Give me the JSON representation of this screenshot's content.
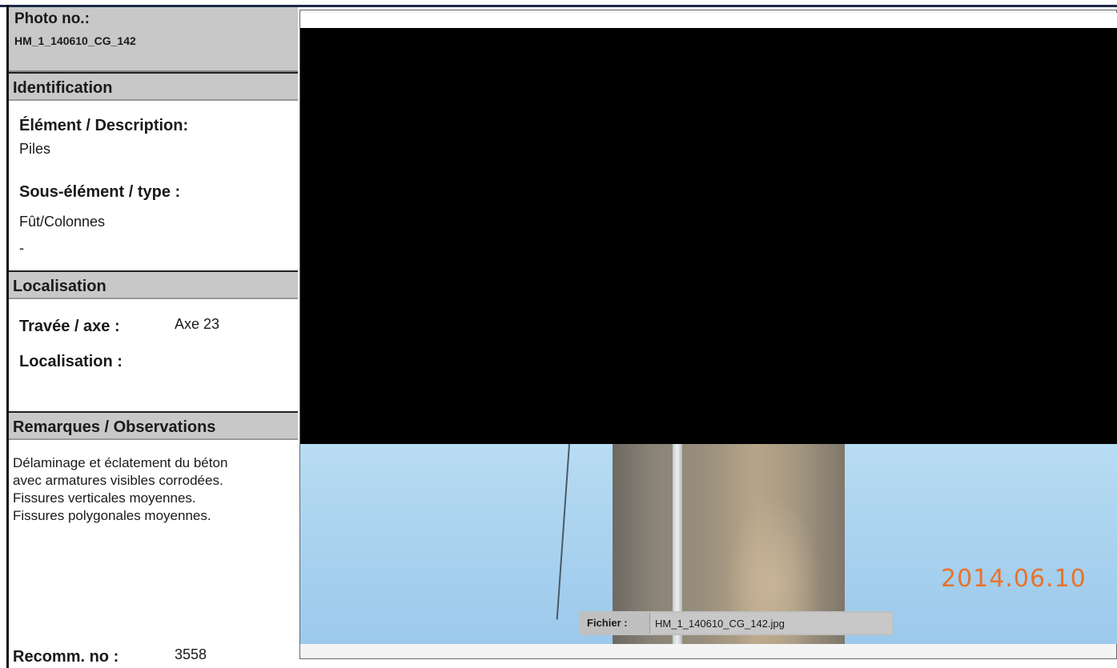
{
  "photo": {
    "label": "Photo no.:",
    "number": "HM_1_140610_CG_142"
  },
  "identification": {
    "header": "Identification",
    "element_label": "Élément / Description:",
    "element_value": "Piles",
    "subelement_label": "Sous-élément / type :",
    "subelement_value": "Fût/Colonnes",
    "extra": "-"
  },
  "localisation": {
    "header": "Localisation",
    "travee_label": "Travée / axe :",
    "travee_value": "Axe 23",
    "localisation_label": "Localisation :"
  },
  "remarks": {
    "header": "Remarques / Observations",
    "lines": [
      "Délaminage et éclatement du béton",
      "avec armatures visibles corrodées.",
      "Fissures verticales moyennes.",
      "Fissures polygonales moyennes."
    ]
  },
  "recommendation": {
    "label": "Recomm. no :",
    "value": "3558"
  },
  "image": {
    "date_stamp": "2014.06.10",
    "file_label": "Fichier :",
    "file_name": "HM_1_140610_CG_142.jpg",
    "date_color": "#e8732a"
  }
}
